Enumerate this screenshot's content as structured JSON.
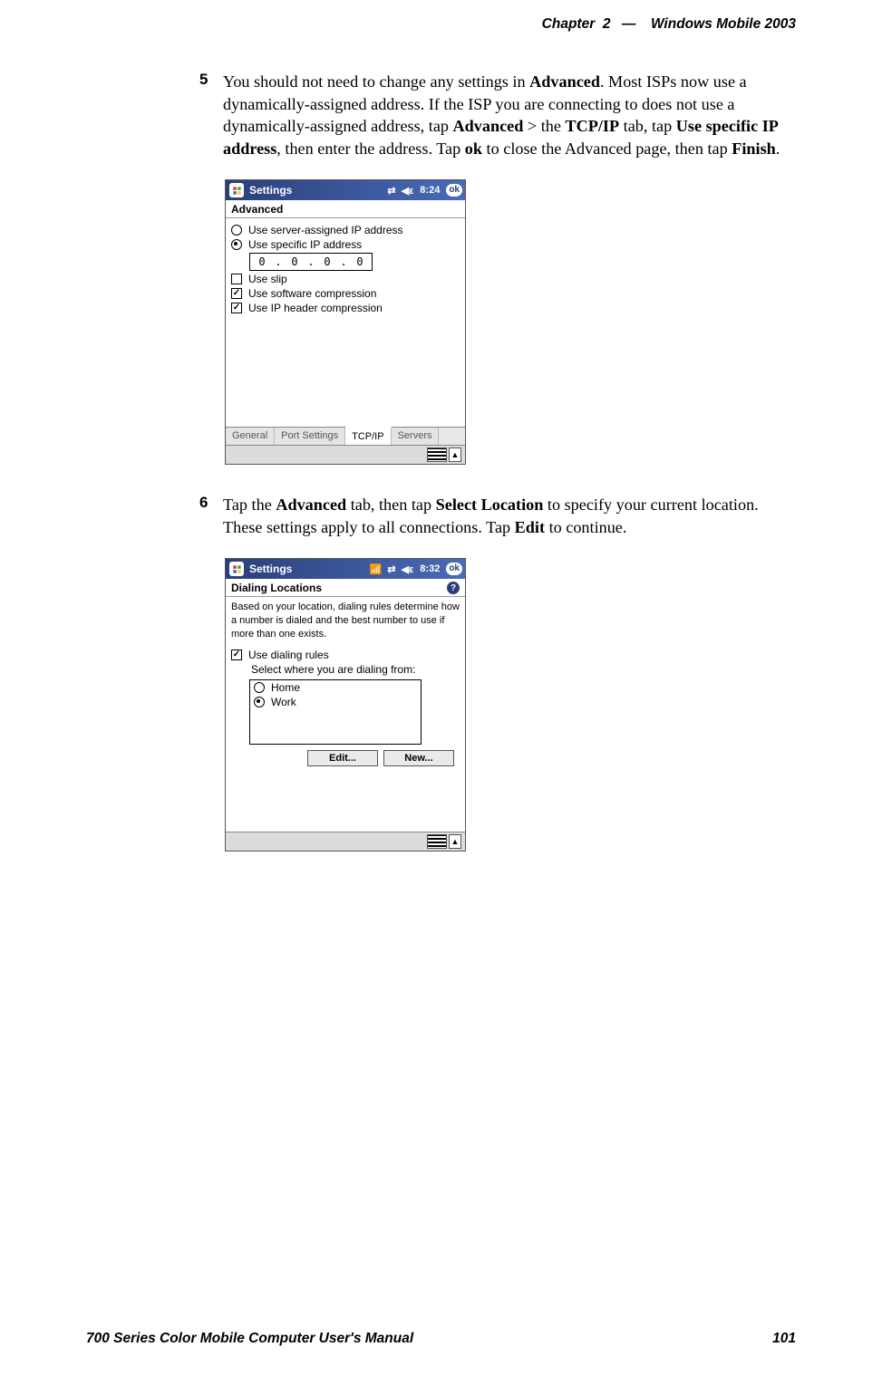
{
  "header": {
    "chapter": "Chapter",
    "chapnum": "2",
    "dash": "—",
    "title": "Windows Mobile 2003"
  },
  "footer": {
    "manual": "700 Series Color Mobile Computer User's Manual",
    "page": "101"
  },
  "step5": {
    "num": "5",
    "t1": "You should not need to change any settings in ",
    "b1": "Advanced",
    "t2": ". Most ISPs now use a dynamically-assigned address. If the ISP you are connecting to does not use a dynamically-assigned address, tap ",
    "b2": "Advanced",
    "t3": " > the ",
    "b3": "TCP/IP",
    "t4": " tab, tap ",
    "b4": "Use specific IP address",
    "t5": ", then enter the address. Tap ",
    "b5": "ok",
    "t6": " to close the Advanced page, then tap ",
    "b6": "Finish",
    "t7": "."
  },
  "step6": {
    "num": "6",
    "t1": "Tap the ",
    "b1": "Advanced",
    "t2": " tab, then tap ",
    "b2": "Select Location",
    "t3": " to specify your current location. These settings apply to all connections. Tap ",
    "b3": "Edit",
    "t4": " to continue."
  },
  "shot1": {
    "tb_title": "Settings",
    "time": "8:24",
    "subtitle": "Advanced",
    "opt_server": "Use server-assigned IP address",
    "opt_specific": "Use specific IP address",
    "ip": [
      "0",
      "0",
      "0",
      "0"
    ],
    "chk_slip": "Use slip",
    "chk_swcomp": "Use software compression",
    "chk_iphdr": "Use IP header compression",
    "tabs": [
      "General",
      "Port Settings",
      "TCP/IP",
      "Servers"
    ],
    "ok": "ok"
  },
  "shot2": {
    "tb_title": "Settings",
    "time": "8:32",
    "subtitle": "Dialing Locations",
    "desc": "Based on your location, dialing rules determine how a number is dialed and the best number to use if more than one exists.",
    "chk_rules": "Use dialing rules",
    "label_select": "Select where you are dialing from:",
    "list": [
      {
        "label": "Home",
        "sel": false
      },
      {
        "label": "Work",
        "sel": true
      }
    ],
    "btn_edit": "Edit...",
    "btn_new": "New...",
    "ok": "ok"
  }
}
